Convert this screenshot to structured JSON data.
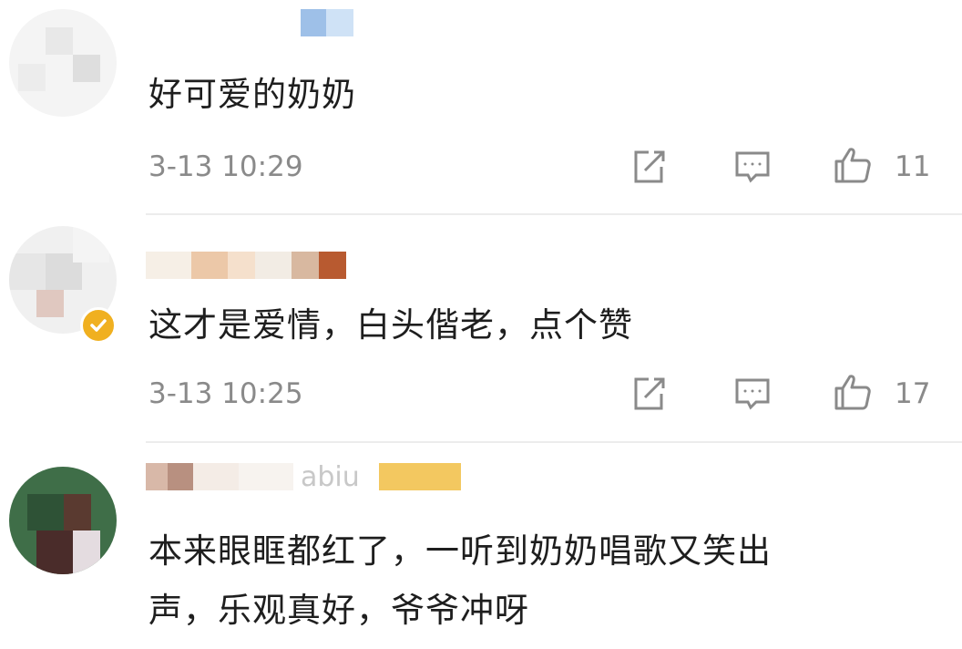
{
  "comments": [
    {
      "text": "好可爱的奶奶",
      "time": "3-13 10:29",
      "likes": "11"
    },
    {
      "text": "这才是爱情，白头偕老，点个赞",
      "time": "3-13 10:25",
      "likes": "17",
      "verified": true
    },
    {
      "text_line1": "本来眼眶都红了，一听到奶奶唱歌又笑出",
      "text_line2": "声，乐观真好，爷爷冲呀",
      "name_fragment": "abiu"
    }
  ],
  "icons": {
    "share": "share-icon",
    "reply": "comment-icon",
    "like": "thumbs-up-icon",
    "verified": "verified-badge-icon"
  },
  "colors": {
    "text": "#1e1e1e",
    "meta": "#8a8a8a",
    "badge": "#f0b020",
    "divider": "#ececec"
  }
}
